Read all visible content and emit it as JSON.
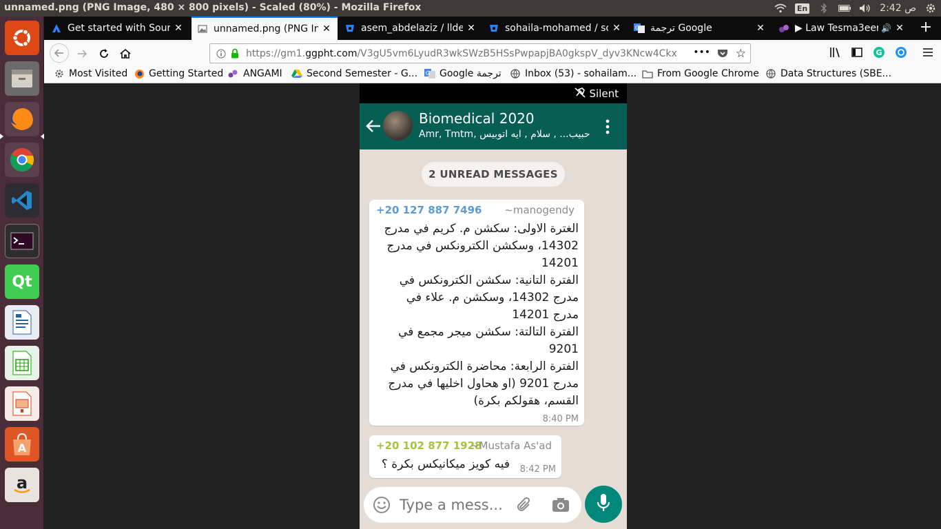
{
  "panel": {
    "window_title": "unnamed.png (PNG Image, 480 × 800 pixels) - Scaled (80%) - Mozilla Firefox",
    "keyboard_layout": "En",
    "clock": "2:42 ص"
  },
  "launcher": {
    "items": [
      "ubuntu-dash-icon",
      "files-icon",
      "firefox-icon",
      "chrome-icon",
      "vscode-icon",
      "terminal-icon",
      "qt-creator-icon",
      "libreoffice-writer-icon",
      "libreoffice-calc-icon",
      "libreoffice-impress-icon",
      "software-center-icon",
      "amazon-icon"
    ]
  },
  "tabs": [
    {
      "label": "Get started with Sourc",
      "icon": "atlassian-icon",
      "active": false
    },
    {
      "label": "unnamed.png (PNG In",
      "icon": "image-icon",
      "active": true
    },
    {
      "label": "asem_abdelaziz / llder",
      "icon": "bitbucket-icon",
      "active": false
    },
    {
      "label": "sohaila-mohamed / so",
      "icon": "bitbucket-icon",
      "active": false
    },
    {
      "label": "ترجمة Google",
      "icon": "google-translate-icon",
      "active": false
    },
    {
      "label": "▶ Law Tesma3eeny",
      "icon": "music-icon",
      "active": false
    }
  ],
  "navbar": {
    "url_scheme": "https://gm1.",
    "url_host": "ggpht.com",
    "url_path": "/V3gU5vm6LyudR3wkSWzB5HSsPwpapjBA0gkspV_dyv3KNcw4Ckx",
    "more": "•••"
  },
  "bookmarks": [
    {
      "label": "Most Visited",
      "icon": "gear-icon"
    },
    {
      "label": "Getting Started",
      "icon": "firefox-icon"
    },
    {
      "label": "ANGAMI",
      "icon": "angami-icon"
    },
    {
      "label": "Second Semester - G...",
      "icon": "drive-icon"
    },
    {
      "label": "Google ترجمة",
      "icon": "google-translate-icon"
    },
    {
      "label": "Inbox (53) - sohailam...",
      "icon": "globe-icon"
    },
    {
      "label": "From Google Chrome",
      "icon": "folder-icon"
    },
    {
      "label": "Data Structures (SBE...",
      "icon": "globe-icon"
    }
  ],
  "whatsapp": {
    "status_silent": "Silent",
    "group_name": "Biomedical 2020",
    "group_members": "Amr, Tmtm, حبيب... , سلام , ايه اتوبيس",
    "unread_label": "2 UNREAD MESSAGES",
    "messages": [
      {
        "phone": "+20 127 887 7496",
        "alias": "~manogendy",
        "phone_color": "#5b9bd5",
        "text": "الغترة الاولى: سكشن م. كريم في مدرج 14302، وسكشن الكترونكس في مدرج 14201\nالفترة التانية: سكشن الكترونكس في مدرج 14302، وسكشن م. علاء في مدرج 14201\nالفترة التالتة: سكشن ميجر مجمع في 9201\nالفترة الرابعة: محاضرة الكترونكس في مدرج 9201 (او هحاول اخليها في مدرج القسم، هقولكم بكرة)",
        "time": "8:40 PM"
      },
      {
        "phone": "+20 102 877 1928",
        "alias": "~Mustafa As'ad",
        "phone_color": "#a3c43b",
        "text": "فيه كويز ميكانيكس بكرة ؟",
        "time": "8:42 PM"
      }
    ],
    "composer_placeholder": "Type a mess..."
  },
  "colors": {
    "whatsapp_header": "#075e54",
    "whatsapp_mic": "#00897b",
    "firefox_accent": "#0a84ff",
    "launcher_bg": "#4b2d3a"
  }
}
